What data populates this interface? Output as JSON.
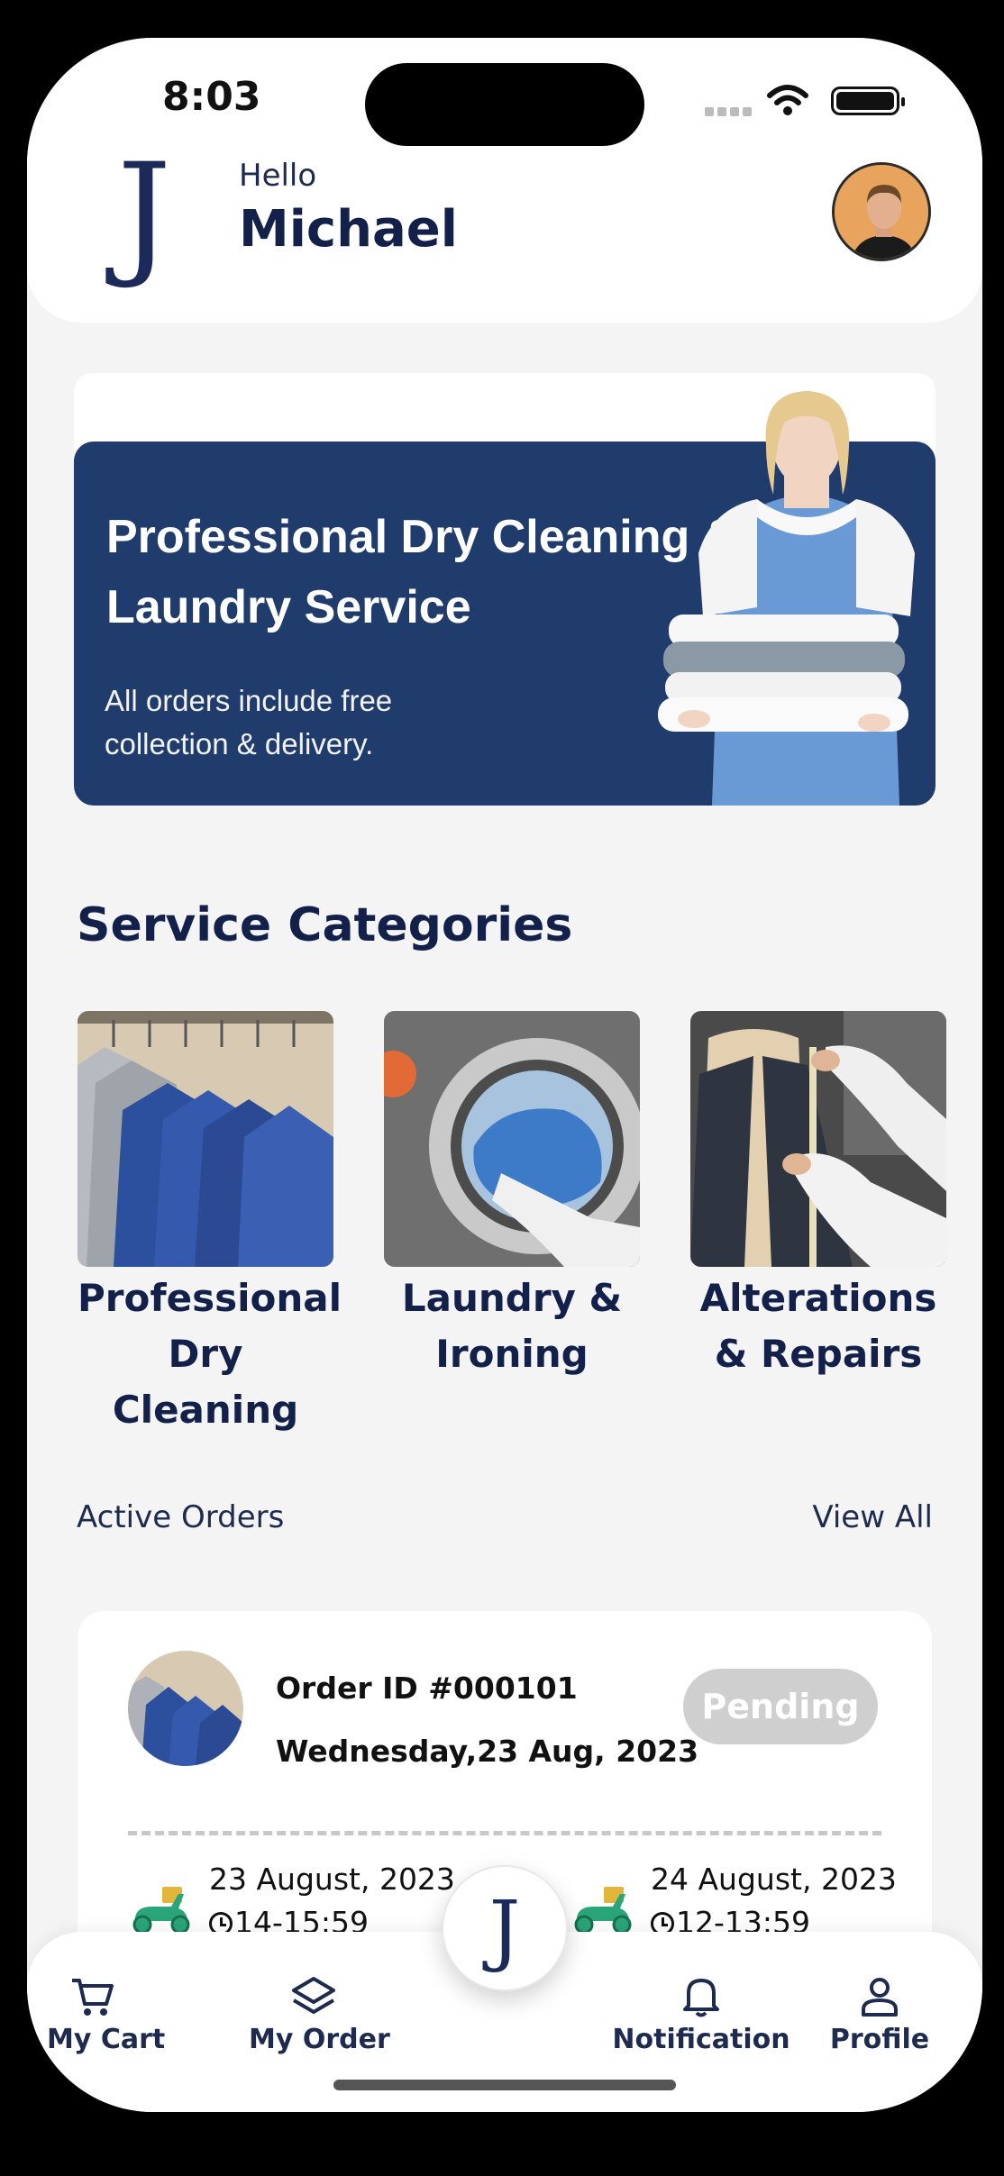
{
  "status_bar": {
    "time": "8:03"
  },
  "header": {
    "logo_letter": "J",
    "greeting": "Hello",
    "username": "Michael"
  },
  "banner": {
    "title": "Professional Dry Cleaning & Laundry Service",
    "subtitle": "All orders include free collection & delivery."
  },
  "categories": {
    "title": "Service Categories",
    "items": [
      {
        "label": "Professional Dry Cleaning",
        "icon": "suits-rack-image"
      },
      {
        "label": "Laundry & Ironing",
        "icon": "washing-machine-image"
      },
      {
        "label": "Alterations & Repairs",
        "icon": "tailor-image"
      }
    ]
  },
  "orders": {
    "title": "Active Orders",
    "view_all": "View All",
    "items": [
      {
        "order_id": "Order ID #000101",
        "date": "Wednesday,23 Aug, 2023",
        "status": "Pending",
        "pickup_date": "23 August, 2023",
        "pickup_time": "14-15:59",
        "delivery_date": "24 August, 2023",
        "delivery_time": "12-13:59"
      }
    ]
  },
  "bottom_nav": {
    "cart": "My Cart",
    "order": "My Order",
    "center_letter": "J",
    "notification": "Notification",
    "profile": "Profile"
  },
  "colors": {
    "primary": "#12204a",
    "banner": "#203c6c",
    "badge": "#cfcfcf",
    "scooter": "#2aa57a"
  }
}
